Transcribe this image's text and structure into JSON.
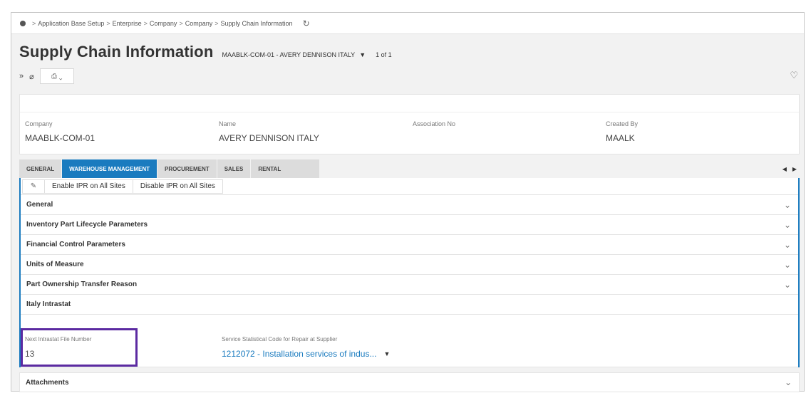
{
  "breadcrumb": {
    "items": [
      "Application Base Setup",
      "Enterprise",
      "Company",
      "Company",
      "Supply Chain Information"
    ],
    "separator": ">",
    "refresh_icon": "↻"
  },
  "title": "Supply Chain Information",
  "record": {
    "selector": "MAABLK-COM-01 - AVERY DENNISON ITALY",
    "caret": "▼",
    "count": "1 of 1"
  },
  "toolbar": {
    "expand_icon": "»",
    "attach_icon": "⌀",
    "dropdown_icon": "⎙ ⌄"
  },
  "favorite_icon": "♡",
  "header_fields": [
    {
      "label": "Company",
      "value": "MAABLK-COM-01"
    },
    {
      "label": "Name",
      "value": "AVERY DENNISON ITALY"
    },
    {
      "label": "Association No",
      "value": ""
    },
    {
      "label": "Created By",
      "value": "MAALK"
    }
  ],
  "tabs": [
    "GENERAL",
    "WAREHOUSE MANAGEMENT",
    "PROCUREMENT",
    "SALES",
    "RENTAL"
  ],
  "active_tab": "WAREHOUSE MANAGEMENT",
  "tab_arrows": {
    "left": "◀",
    "right": "▶"
  },
  "commands": {
    "edit_icon": "✎",
    "enable": "Enable IPR on All Sites",
    "disable": "Disable IPR on All Sites"
  },
  "sections": [
    "General",
    "Inventory Part Lifecycle Parameters",
    "Financial Control Parameters",
    "Units of Measure",
    "Part Ownership Transfer Reason"
  ],
  "chevron": "⌄",
  "intrastat": {
    "title": "Italy Intrastat",
    "next_file_label": "Next Intrastat File Number",
    "next_file_value": "13",
    "service_code_label": "Service Statistical Code for Repair at Supplier",
    "service_code_value": "1212072 - Installation services of indus...",
    "service_caret": "▼"
  },
  "attachments": "Attachments",
  "colors": {
    "accent": "#1a7bbf",
    "highlight": "#5b2aa1"
  }
}
